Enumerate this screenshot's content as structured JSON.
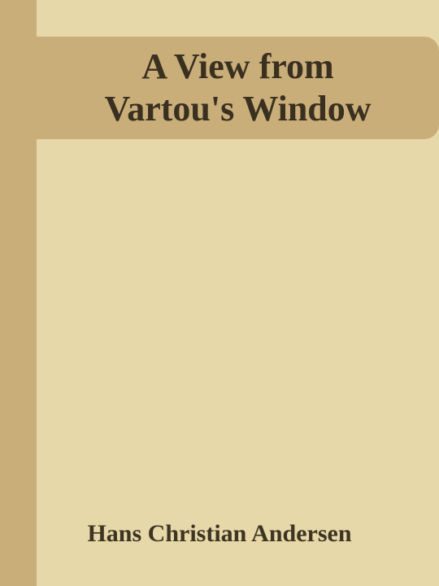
{
  "cover": {
    "title_line_1": "A View from",
    "title_line_2": "Vartou's Window",
    "author": "Hans Christian Andersen"
  },
  "colors": {
    "background": "#e6d8a8",
    "accent": "#c9ae7a",
    "text": "#3a3020"
  }
}
